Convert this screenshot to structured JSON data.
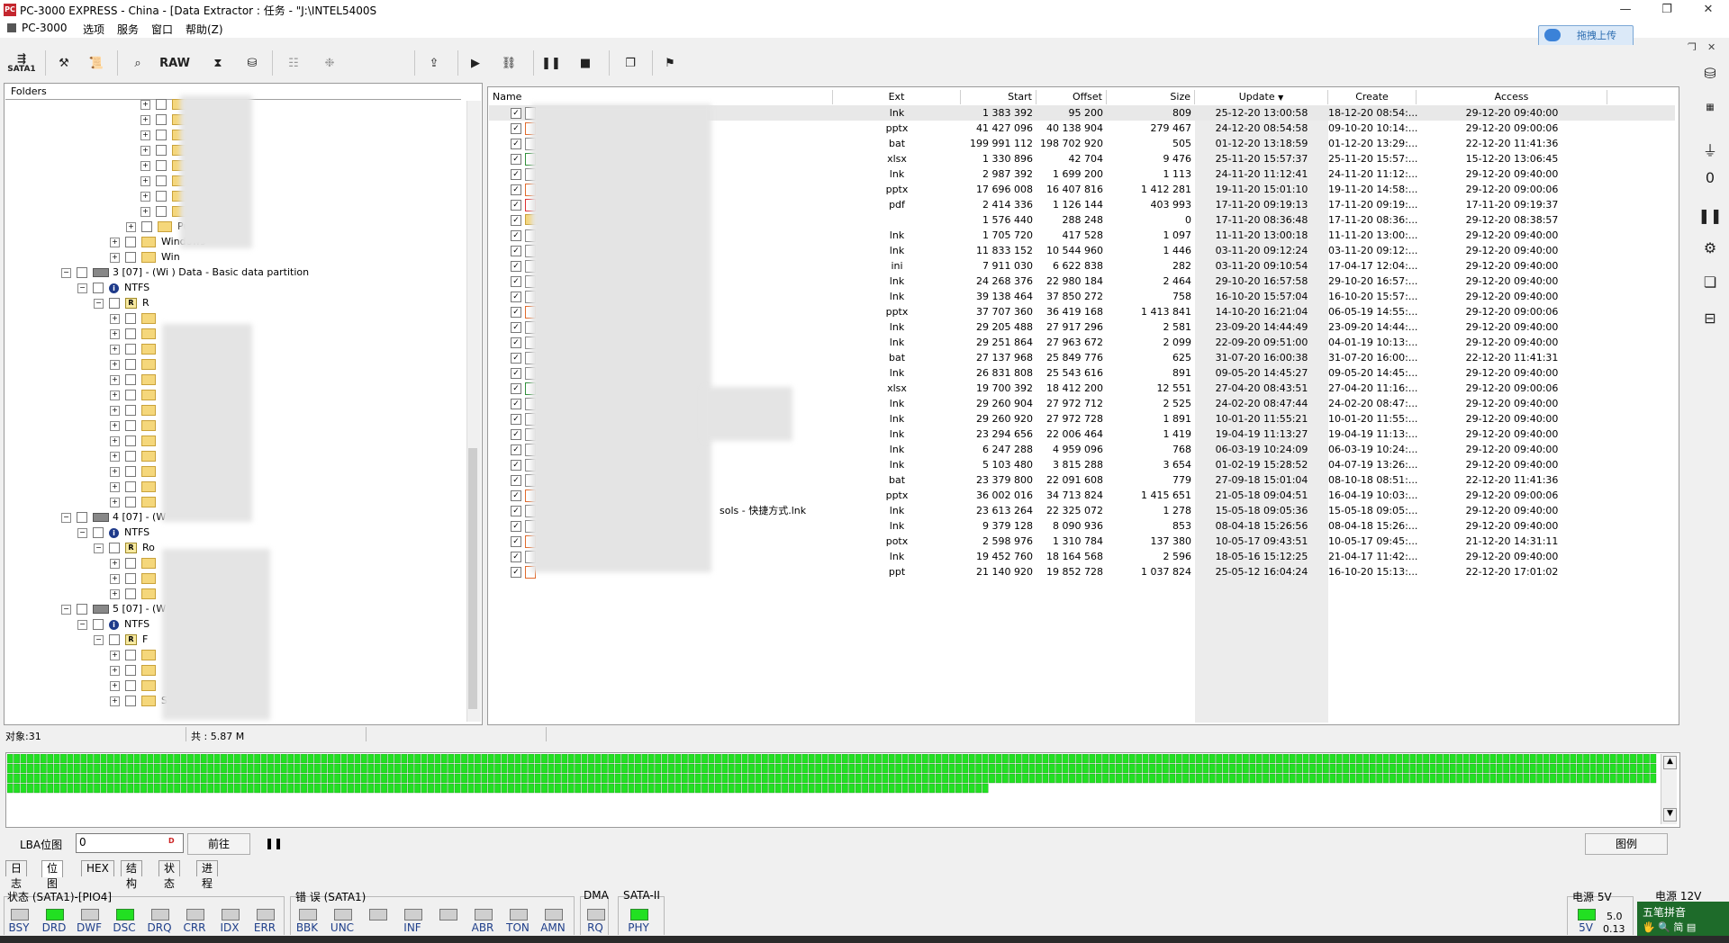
{
  "window": {
    "app_icon": "PC",
    "title": "PC-3000 EXPRESS - China - [Data Extractor : 任务 - \"J:\\INTEL5400S",
    "controls": [
      "—",
      "❐",
      "✕"
    ]
  },
  "menu": {
    "items": [
      "PC-3000",
      "选项",
      "服务",
      "窗口",
      "帮助(Z)"
    ],
    "upload_label": "拖拽上传"
  },
  "toolbar": {
    "sata_label": "SATA1",
    "raw_label": "RAW"
  },
  "tree": {
    "header": "Folders",
    "rows": [
      {
        "indent": 150,
        "exp": "+",
        "type": "folder",
        "label": "ures"
      },
      {
        "indent": 150,
        "exp": "+",
        "type": "folder",
        "label": ""
      },
      {
        "indent": 150,
        "exp": "+",
        "type": "folder",
        "label": "nes"
      },
      {
        "indent": 150,
        "exp": "+",
        "type": "folder",
        "label": ""
      },
      {
        "indent": 150,
        "exp": "+",
        "type": "folder",
        "label": ""
      },
      {
        "indent": 150,
        "exp": "+",
        "type": "folder",
        "label": ""
      },
      {
        "indent": 150,
        "exp": "+",
        "type": "folder",
        "label": ""
      },
      {
        "indent": 150,
        "exp": "+",
        "type": "folder",
        "label": ""
      },
      {
        "indent": 134,
        "exp": "+",
        "type": "folder",
        "label": "Public"
      },
      {
        "indent": 116,
        "exp": "+",
        "type": "folder",
        "label": "Windows"
      },
      {
        "indent": 116,
        "exp": "+",
        "type": "folder",
        "label": "Win"
      },
      {
        "indent": 62,
        "exp": "−",
        "type": "drive",
        "label": "3 [07] - (Wi          ) Data - Basic data partition"
      },
      {
        "indent": 80,
        "exp": "−",
        "type": "ntfs",
        "label": "NTFS"
      },
      {
        "indent": 98,
        "exp": "−",
        "type": "root",
        "label": "R"
      },
      {
        "indent": 116,
        "exp": "+",
        "type": "folder",
        "label": ""
      },
      {
        "indent": 116,
        "exp": "+",
        "type": "folder",
        "label": ""
      },
      {
        "indent": 116,
        "exp": "+",
        "type": "folder",
        "label": ""
      },
      {
        "indent": 116,
        "exp": "+",
        "type": "folder",
        "label": ""
      },
      {
        "indent": 116,
        "exp": "+",
        "type": "folder",
        "label": ""
      },
      {
        "indent": 116,
        "exp": "+",
        "type": "folder",
        "label": ""
      },
      {
        "indent": 116,
        "exp": "+",
        "type": "folder",
        "label": ""
      },
      {
        "indent": 116,
        "exp": "+",
        "type": "folder",
        "label": ""
      },
      {
        "indent": 116,
        "exp": "+",
        "type": "folder",
        "label": ""
      },
      {
        "indent": 116,
        "exp": "+",
        "type": "folder",
        "label": ""
      },
      {
        "indent": 116,
        "exp": "+",
        "type": "folder",
        "label": ""
      },
      {
        "indent": 116,
        "exp": "+",
        "type": "folder",
        "label": ""
      },
      {
        "indent": 116,
        "exp": "+",
        "type": "folder",
        "label": ""
      },
      {
        "indent": 62,
        "exp": "−",
        "type": "drive",
        "label": "4 [07] - (W"
      },
      {
        "indent": 80,
        "exp": "−",
        "type": "ntfs",
        "label": "NTFS"
      },
      {
        "indent": 98,
        "exp": "−",
        "type": "root",
        "label": "Ro"
      },
      {
        "indent": 116,
        "exp": "+",
        "type": "folder",
        "label": ""
      },
      {
        "indent": 116,
        "exp": "+",
        "type": "folder",
        "label": ""
      },
      {
        "indent": 116,
        "exp": "+",
        "type": "folder",
        "label": ""
      },
      {
        "indent": 62,
        "exp": "−",
        "type": "drive",
        "label": "5 [07] - (W"
      },
      {
        "indent": 80,
        "exp": "−",
        "type": "ntfs",
        "label": "NTFS"
      },
      {
        "indent": 98,
        "exp": "−",
        "type": "root",
        "label": "F"
      },
      {
        "indent": 116,
        "exp": "+",
        "type": "folder",
        "label": ""
      },
      {
        "indent": 116,
        "exp": "+",
        "type": "folder",
        "label": ""
      },
      {
        "indent": 116,
        "exp": "+",
        "type": "folder",
        "label": ""
      },
      {
        "indent": 116,
        "exp": "+",
        "type": "folder",
        "label": "Sy"
      }
    ]
  },
  "table": {
    "columns": [
      "Name",
      "Ext",
      "Start",
      "Offset",
      "Size",
      "Update",
      "Create",
      "Access"
    ],
    "rows": [
      [
        "lnk",
        "1 383 392",
        "95 200",
        "809",
        "25-12-20 13:00:58",
        "18-12-20 08:54:...",
        "29-12-20 09:40:00"
      ],
      [
        "pptx",
        "41 427 096",
        "40 138 904",
        "279 467",
        "24-12-20 08:54:58",
        "09-10-20 10:14:...",
        "29-12-20 09:00:06"
      ],
      [
        "bat",
        "199 991 112",
        "198 702 920",
        "505",
        "01-12-20 13:18:59",
        "01-12-20 13:29:...",
        "22-12-20 11:41:36"
      ],
      [
        "xlsx",
        "1 330 896",
        "42 704",
        "9 476",
        "25-11-20 15:57:37",
        "25-11-20 15:57:...",
        "15-12-20 13:06:45"
      ],
      [
        "lnk",
        "2 987 392",
        "1 699 200",
        "1 113",
        "24-11-20 11:12:41",
        "24-11-20 11:12:...",
        "29-12-20 09:40:00"
      ],
      [
        "pptx",
        "17 696 008",
        "16 407 816",
        "1 412 281",
        "19-11-20 15:01:10",
        "19-11-20 14:58:...",
        "29-12-20 09:00:06"
      ],
      [
        "pdf",
        "2 414 336",
        "1 126 144",
        "403 993",
        "17-11-20 09:19:13",
        "17-11-20 09:19:...",
        "17-11-20 09:19:37"
      ],
      [
        "",
        "1 576 440",
        "288 248",
        "0",
        "17-11-20 08:36:48",
        "17-11-20 08:36:...",
        "29-12-20 08:38:57"
      ],
      [
        "lnk",
        "1 705 720",
        "417 528",
        "1 097",
        "11-11-20 13:00:18",
        "11-11-20 13:00:...",
        "29-12-20 09:40:00"
      ],
      [
        "lnk",
        "11 833 152",
        "10 544 960",
        "1 446",
        "03-11-20 09:12:24",
        "03-11-20 09:12:...",
        "29-12-20 09:40:00"
      ],
      [
        "ini",
        "7 911 030",
        "6 622 838",
        "282",
        "03-11-20 09:10:54",
        "17-04-17 12:04:...",
        "29-12-20 09:40:00"
      ],
      [
        "lnk",
        "24 268 376",
        "22 980 184",
        "2 464",
        "29-10-20 16:57:58",
        "29-10-20 16:57:...",
        "29-12-20 09:40:00"
      ],
      [
        "lnk",
        "39 138 464",
        "37 850 272",
        "758",
        "16-10-20 15:57:04",
        "16-10-20 15:57:...",
        "29-12-20 09:40:00"
      ],
      [
        "pptx",
        "37 707 360",
        "36 419 168",
        "1 413 841",
        "14-10-20 16:21:04",
        "06-05-19 14:55:...",
        "29-12-20 09:00:06"
      ],
      [
        "lnk",
        "29 205 488",
        "27 917 296",
        "2 581",
        "23-09-20 14:44:49",
        "23-09-20 14:44:...",
        "29-12-20 09:40:00"
      ],
      [
        "lnk",
        "29 251 864",
        "27 963 672",
        "2 099",
        "22-09-20 09:51:00",
        "04-01-19 10:13:...",
        "29-12-20 09:40:00"
      ],
      [
        "bat",
        "27 137 968",
        "25 849 776",
        "625",
        "31-07-20 16:00:38",
        "31-07-20 16:00:...",
        "22-12-20 11:41:31"
      ],
      [
        "lnk",
        "26 831 808",
        "25 543 616",
        "891",
        "09-05-20 14:45:27",
        "09-05-20 14:45:...",
        "29-12-20 09:40:00"
      ],
      [
        "xlsx",
        "19 700 392",
        "18 412 200",
        "12 551",
        "27-04-20 08:43:51",
        "27-04-20 11:16:...",
        "29-12-20 09:00:06"
      ],
      [
        "lnk",
        "29 260 904",
        "27 972 712",
        "2 525",
        "24-02-20 08:47:44",
        "24-02-20 08:47:...",
        "29-12-20 09:40:00"
      ],
      [
        "lnk",
        "29 260 920",
        "27 972 728",
        "1 891",
        "10-01-20 11:55:21",
        "10-01-20 11:55:...",
        "29-12-20 09:40:00"
      ],
      [
        "lnk",
        "23 294 656",
        "22 006 464",
        "1 419",
        "19-04-19 11:13:27",
        "19-04-19 11:13:...",
        "29-12-20 09:40:00"
      ],
      [
        "lnk",
        "6 247 288",
        "4 959 096",
        "768",
        "06-03-19 10:24:09",
        "06-03-19 10:24:...",
        "29-12-20 09:40:00"
      ],
      [
        "lnk",
        "5 103 480",
        "3 815 288",
        "3 654",
        "01-02-19 15:28:52",
        "04-07-19 13:26:...",
        "29-12-20 09:40:00"
      ],
      [
        "bat",
        "23 379 800",
        "22 091 608",
        "779",
        "27-09-18 15:01:04",
        "08-10-18 08:51:...",
        "22-12-20 11:41:36"
      ],
      [
        "pptx",
        "36 002 016",
        "34 713 824",
        "1 415 651",
        "21-05-18 09:04:51",
        "16-04-19 10:03:...",
        "29-12-20 09:00:06"
      ],
      [
        "lnk",
        "23 613 264",
        "22 325 072",
        "1 278",
        "15-05-18 09:05:36",
        "15-05-18 09:05:...",
        "29-12-20 09:40:00"
      ],
      [
        "lnk",
        "9 379 128",
        "8 090 936",
        "853",
        "08-04-18 15:26:56",
        "08-04-18 15:26:...",
        "29-12-20 09:40:00"
      ],
      [
        "potx",
        "2 598 976",
        "1 310 784",
        "137 380",
        "10-05-17 09:43:51",
        "10-05-17 09:45:...",
        "21-12-20 14:31:11"
      ],
      [
        "lnk",
        "19 452 760",
        "18 164 568",
        "2 596",
        "18-05-16 15:12:25",
        "21-04-17 11:42:...",
        "29-12-20 09:40:00"
      ],
      [
        "ppt",
        "21 140 920",
        "19 852 728",
        "1 037 824",
        "25-05-12 16:04:24",
        "16-10-20 15:13:...",
        "22-12-20 17:01:02"
      ]
    ],
    "name_fragments": [
      "",
      "",
      "",
      "",
      "",
      "",
      "",
      "",
      "",
      "",
      "",
      "",
      "",
      "",
      "",
      "",
      "",
      "",
      "",
      "",
      "k",
      "",
      "",
      "",
      "",
      "",
      "sols - 快捷方式.lnk",
      "",
      "",
      "",
      ""
    ]
  },
  "status": {
    "objects": "对象:31",
    "total": "共 : 5.87 M"
  },
  "bitmap": {
    "full_rows": 3,
    "partial_cells": 147,
    "cells_per_row": 247
  },
  "lba": {
    "label": "LBA位图",
    "value": "0",
    "go_label": "前往",
    "legend_label": "图例"
  },
  "tabs": [
    "日志",
    "位图",
    "HEX",
    "结构",
    "状态",
    "进程"
  ],
  "indicators": {
    "status_label": "状态 (SATA1)-[PIO4]",
    "status_leds": [
      [
        "BSY",
        false
      ],
      [
        "DRD",
        true
      ],
      [
        "DWF",
        false
      ],
      [
        "DSC",
        true
      ],
      [
        "DRQ",
        false
      ],
      [
        "CRR",
        false
      ],
      [
        "IDX",
        false
      ],
      [
        "ERR",
        false
      ]
    ],
    "error_label": "错 误 (SATA1)",
    "error_leds": [
      [
        "BBK",
        false
      ],
      [
        "UNC",
        false
      ],
      [
        "",
        false
      ],
      [
        "INF",
        false
      ],
      [
        "",
        false
      ],
      [
        "ABR",
        false
      ],
      [
        "TON",
        false
      ],
      [
        "AMN",
        false
      ]
    ],
    "dma_label": "DMA",
    "dma_leds": [
      [
        "RQ",
        false
      ]
    ],
    "sata_label": "SATA-II",
    "sata_leds": [
      [
        "PHY",
        true
      ]
    ],
    "power5_label": "电源 5V",
    "power5_led": "5V",
    "power5_values": [
      "5.0",
      "0.13"
    ],
    "power12_label": "电源 12V"
  },
  "ime": {
    "name": "五笔拼音",
    "controls": "🖐 🔍 简 ▤"
  },
  "colors": {
    "led_on": "#22e022",
    "bitmap_cell": "#22e022",
    "update_col_bg": "#ececec"
  }
}
